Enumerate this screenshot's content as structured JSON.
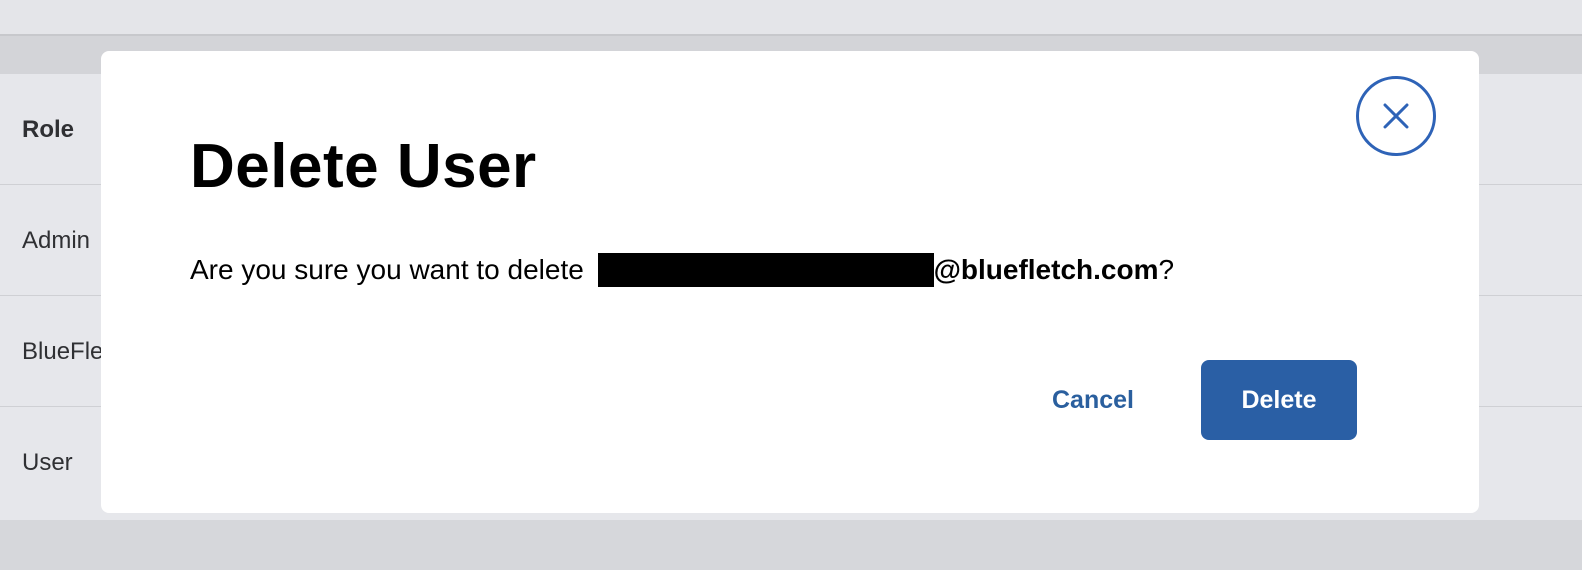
{
  "background": {
    "table_header": "Role",
    "rows": [
      "Admin",
      "BlueFle",
      "User"
    ]
  },
  "modal": {
    "title": "Delete User",
    "message_prefix": "Are you sure you want to delete ",
    "email_domain": "@bluefletch.com",
    "message_suffix": "?",
    "close_icon": "close-icon",
    "cancel_label": "Cancel",
    "delete_label": "Delete"
  },
  "colors": {
    "primary": "#2a5fa5",
    "close_ring": "#2e63b7",
    "cancel_text": "#2a5f9e"
  }
}
